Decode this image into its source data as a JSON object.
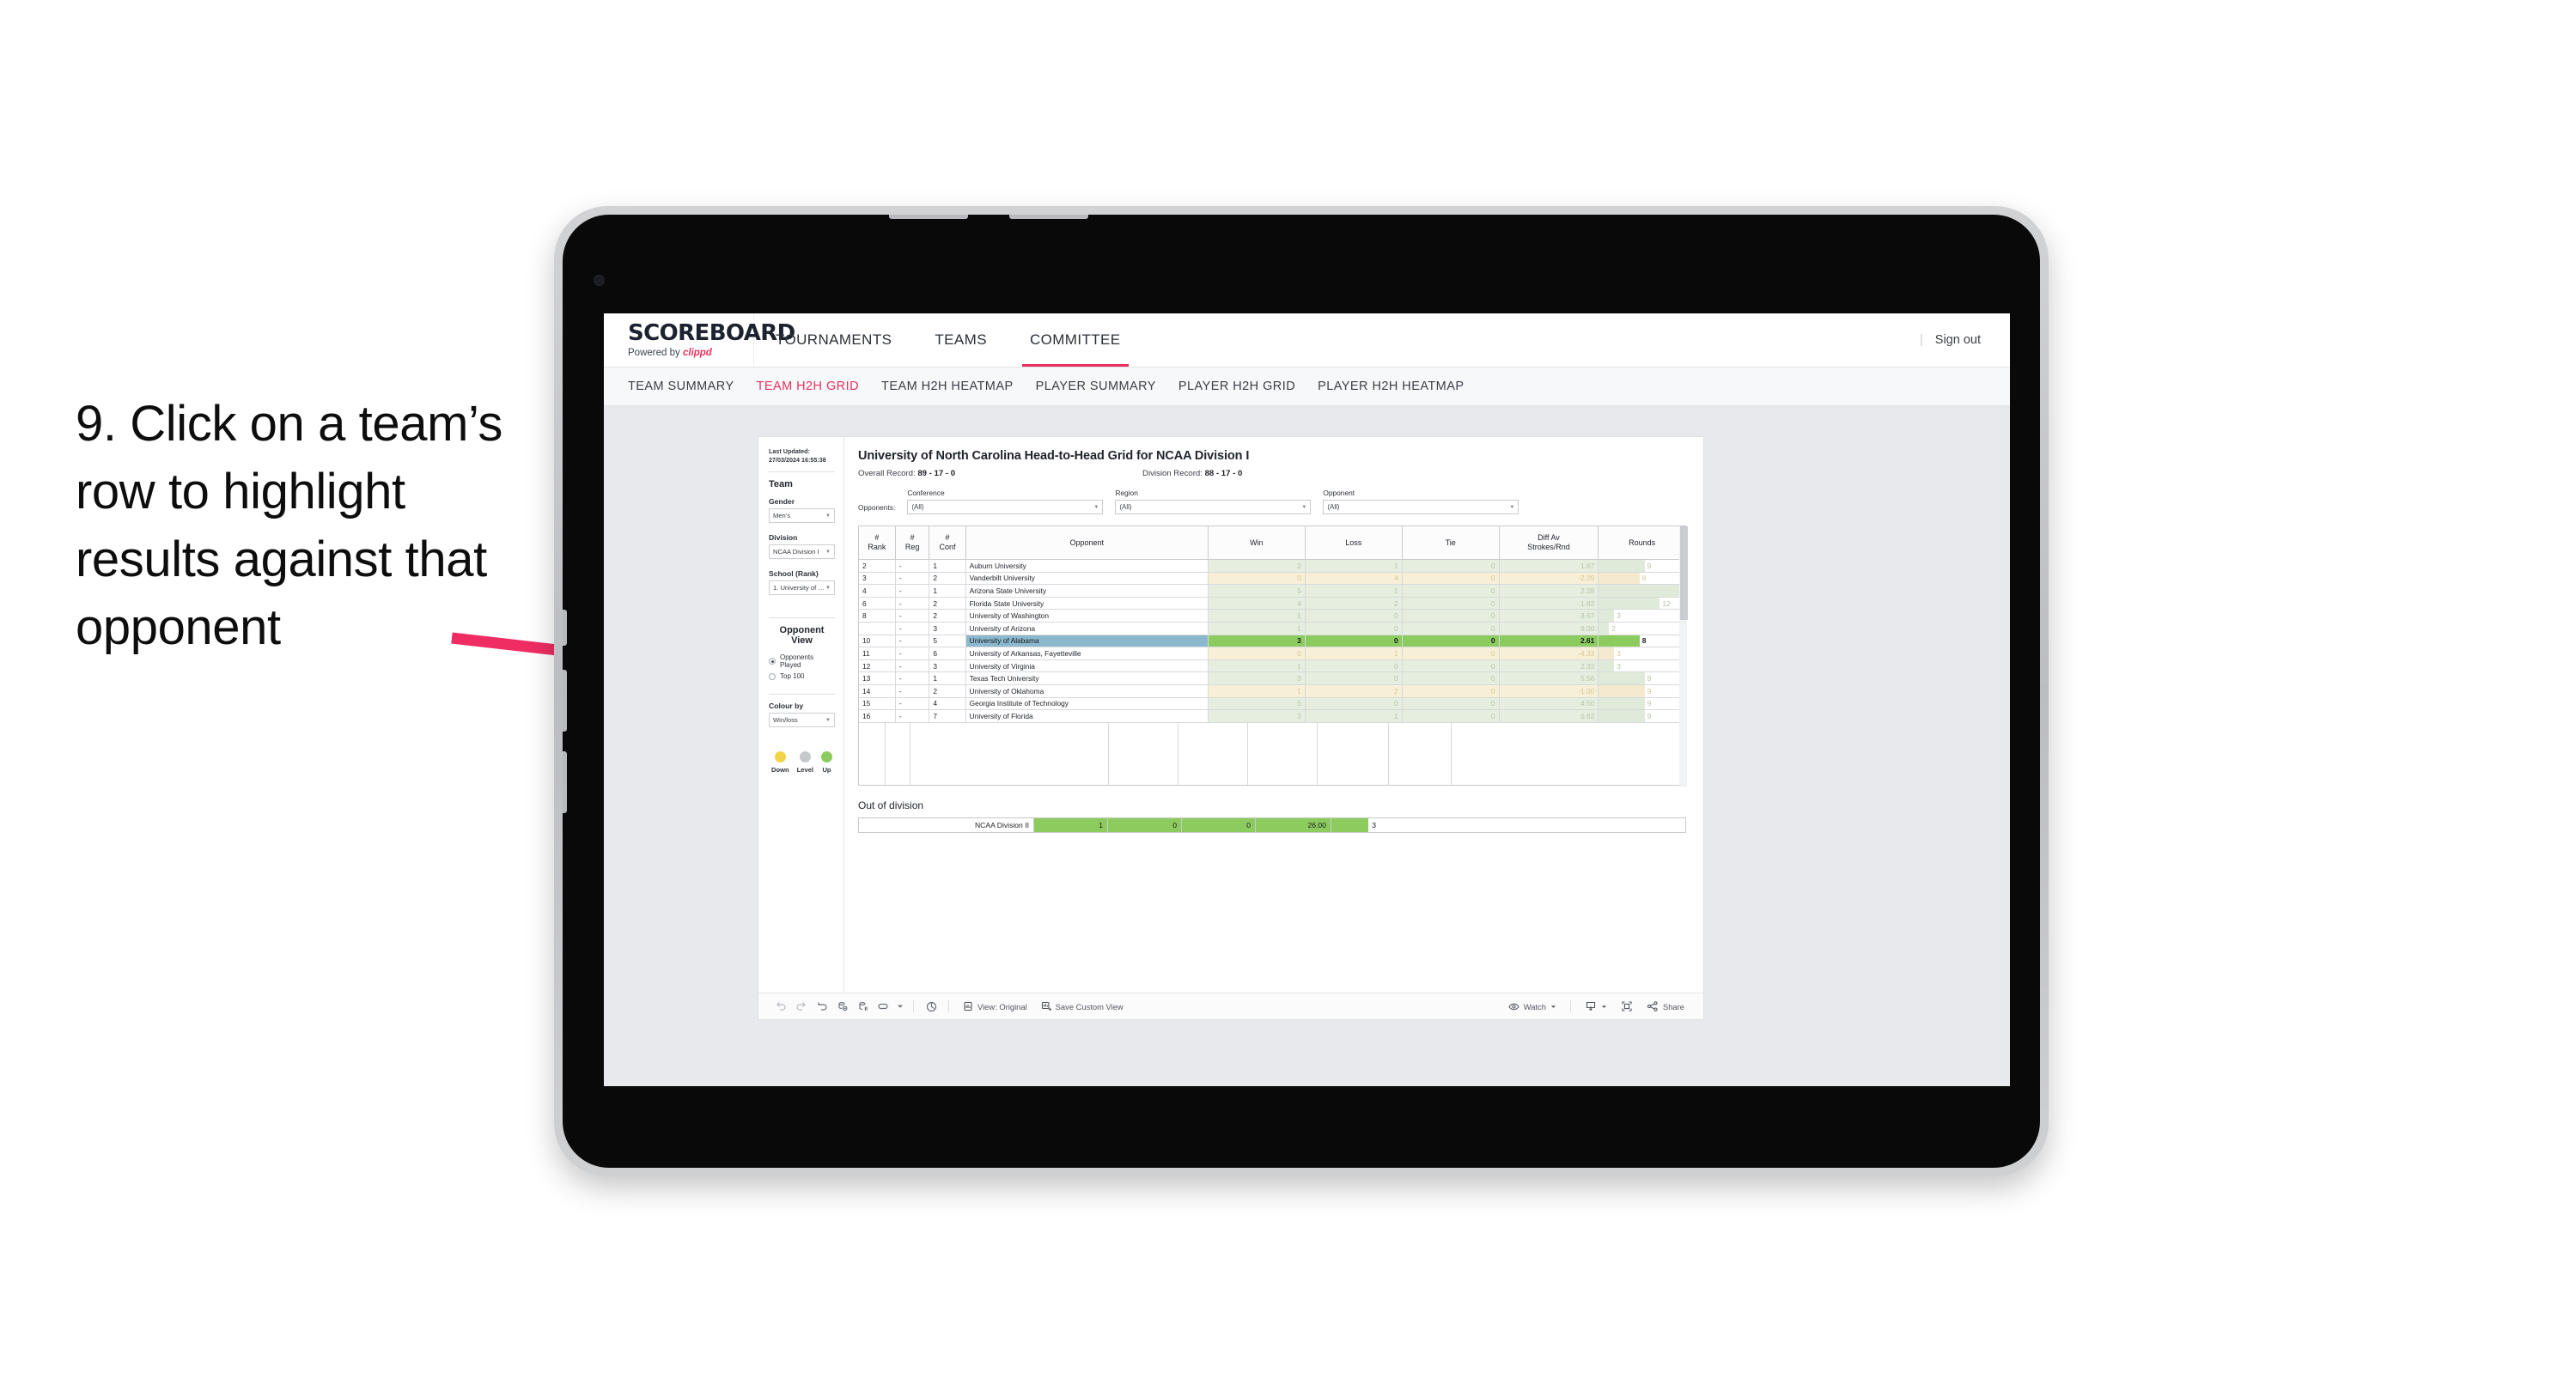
{
  "annotation": {
    "text": "9. Click on a team’s row to highlight results against that opponent",
    "arrow_color": "#ef2d63"
  },
  "app": {
    "logo": "SCOREBOARD",
    "logo_subtitle_prefix": "Powered by ",
    "logo_brand": "clippd",
    "top_nav": [
      {
        "label": "TOURNAMENTS",
        "active": false
      },
      {
        "label": "TEAMS",
        "active": false
      },
      {
        "label": "COMMITTEE",
        "active": true
      }
    ],
    "sign_out": "Sign out",
    "sub_nav": [
      {
        "label": "TEAM SUMMARY",
        "active": false
      },
      {
        "label": "TEAM H2H GRID",
        "active": true
      },
      {
        "label": "TEAM H2H HEATMAP",
        "active": false
      },
      {
        "label": "PLAYER SUMMARY",
        "active": false
      },
      {
        "label": "PLAYER H2H GRID",
        "active": false
      },
      {
        "label": "PLAYER H2H HEATMAP",
        "active": false
      }
    ],
    "accent_color": "#e8315f"
  },
  "sidebar": {
    "last_updated": "Last Updated: 27/03/2024 16:55:38",
    "team_heading": "Team",
    "gender_label": "Gender",
    "gender_value": "Men’s",
    "division_label": "Division",
    "division_value": "NCAA Division I",
    "school_label": "School (Rank)",
    "school_value": "1. University of Nort...",
    "opponent_view_heading": "Opponent View",
    "opponent_view_options": [
      {
        "label": "Opponents Played",
        "selected": true
      },
      {
        "label": "Top 100",
        "selected": false
      }
    ],
    "colour_by_label": "Colour by",
    "colour_by_value": "Win/loss",
    "legend": [
      {
        "label": "Down",
        "color": "#f2d44b"
      },
      {
        "label": "Level",
        "color": "#c5c8cc"
      },
      {
        "label": "Up",
        "color": "#8ccc5f"
      }
    ]
  },
  "main": {
    "title": "University of North Carolina Head-to-Head Grid for NCAA Division I",
    "overall_record_label": "Overall Record: ",
    "overall_record_value": "89 - 17 - 0",
    "division_record_label": "Division Record: ",
    "division_record_value": "88 - 17 - 0",
    "opponents_label": "Opponents:",
    "filters": [
      {
        "name": "Conference",
        "value": "(All)"
      },
      {
        "name": "Region",
        "value": "(All)"
      },
      {
        "name": "Opponent",
        "value": "(All)"
      }
    ],
    "out_of_division_heading": "Out of division"
  },
  "chart_data": {
    "type": "table",
    "title": "University of North Carolina Head-to-Head Grid for NCAA Division I",
    "columns": [
      "# Rank",
      "# Reg",
      "# Conf",
      "Opponent",
      "Win",
      "Loss",
      "Tie",
      "Diff Av Strokes/Rnd",
      "Rounds"
    ],
    "rounds_max": 17,
    "rows": [
      {
        "rank": "2",
        "reg": "-",
        "conf": "1",
        "opponent": "Auburn University",
        "win": "2",
        "loss": "1",
        "tie": "0",
        "diff": "1.67",
        "rounds": "9",
        "tone": "up",
        "selected": false
      },
      {
        "rank": "3",
        "reg": "-",
        "conf": "2",
        "opponent": "Vanderbilt University",
        "win": "0",
        "loss": "4",
        "tie": "0",
        "diff": "-2.29",
        "rounds": "8",
        "tone": "down",
        "selected": false
      },
      {
        "rank": "4",
        "reg": "-",
        "conf": "1",
        "opponent": "Arizona State University",
        "win": "5",
        "loss": "1",
        "tie": "0",
        "diff": "2.28",
        "rounds": "17",
        "tone": "up",
        "selected": false
      },
      {
        "rank": "6",
        "reg": "-",
        "conf": "2",
        "opponent": "Florida State University",
        "win": "4",
        "loss": "2",
        "tie": "0",
        "diff": "1.83",
        "rounds": "12",
        "tone": "up",
        "selected": false
      },
      {
        "rank": "8",
        "reg": "-",
        "conf": "2",
        "opponent": "University of Washington",
        "win": "1",
        "loss": "0",
        "tie": "0",
        "diff": "3.67",
        "rounds": "3",
        "tone": "up",
        "selected": false
      },
      {
        "rank": "",
        "reg": "-",
        "conf": "3",
        "opponent": "University of Arizona",
        "win": "1",
        "loss": "0",
        "tie": "0",
        "diff": "9.00",
        "rounds": "2",
        "tone": "up",
        "selected": false
      },
      {
        "rank": "10",
        "reg": "-",
        "conf": "5",
        "opponent": "University of Alabama",
        "win": "3",
        "loss": "0",
        "tie": "0",
        "diff": "2.61",
        "rounds": "8",
        "tone": "up-sel",
        "selected": true
      },
      {
        "rank": "11",
        "reg": "-",
        "conf": "6",
        "opponent": "University of Arkansas, Fayetteville",
        "win": "0",
        "loss": "1",
        "tie": "0",
        "diff": "-4.33",
        "rounds": "3",
        "tone": "down",
        "selected": false
      },
      {
        "rank": "12",
        "reg": "-",
        "conf": "3",
        "opponent": "University of Virginia",
        "win": "1",
        "loss": "0",
        "tie": "0",
        "diff": "2.33",
        "rounds": "3",
        "tone": "up",
        "selected": false
      },
      {
        "rank": "13",
        "reg": "-",
        "conf": "1",
        "opponent": "Texas Tech University",
        "win": "3",
        "loss": "0",
        "tie": "0",
        "diff": "5.56",
        "rounds": "9",
        "tone": "up",
        "selected": false
      },
      {
        "rank": "14",
        "reg": "-",
        "conf": "2",
        "opponent": "University of Oklahoma",
        "win": "1",
        "loss": "2",
        "tie": "0",
        "diff": "-1.00",
        "rounds": "9",
        "tone": "down",
        "selected": false
      },
      {
        "rank": "15",
        "reg": "-",
        "conf": "4",
        "opponent": "Georgia Institute of Technology",
        "win": "5",
        "loss": "0",
        "tie": "0",
        "diff": "4.50",
        "rounds": "9",
        "tone": "up",
        "selected": false
      },
      {
        "rank": "16",
        "reg": "-",
        "conf": "7",
        "opponent": "University of Florida",
        "win": "3",
        "loss": "1",
        "tie": "0",
        "diff": "6.62",
        "rounds": "9",
        "tone": "up",
        "selected": false
      }
    ],
    "out_of_division": {
      "label": "NCAA Division II",
      "win": "1",
      "loss": "0",
      "tie": "0",
      "diff": "26.00",
      "rounds": "3"
    }
  },
  "toolbar": {
    "view_label": "View: Original",
    "save_label": "Save Custom View",
    "watch_label": "Watch",
    "share_label": "Share"
  }
}
